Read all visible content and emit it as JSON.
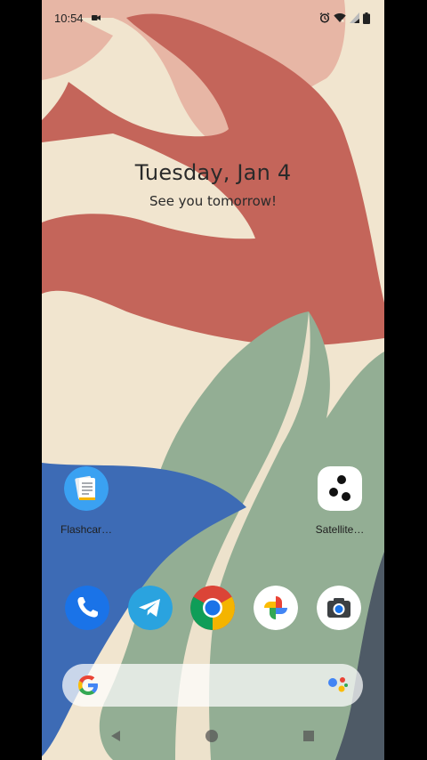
{
  "status_bar": {
    "time": "10:54",
    "icons": [
      "screen-record-icon",
      "alarm-icon",
      "wifi-icon",
      "signal-icon",
      "battery-icon"
    ]
  },
  "glance": {
    "date": "Tuesday, Jan 4",
    "subtitle": "See you tomorrow!"
  },
  "home_apps": [
    {
      "label": "Flashcar…",
      "icon": "flashcards-app-icon"
    },
    {
      "label": "Satellite…",
      "icon": "satellite-app-icon"
    }
  ],
  "dock": [
    {
      "icon": "phone-app-icon"
    },
    {
      "icon": "telegram-app-icon"
    },
    {
      "icon": "chrome-app-icon"
    },
    {
      "icon": "photos-app-icon"
    },
    {
      "icon": "camera-app-icon"
    }
  ],
  "search": {
    "icons": [
      "google-g-icon",
      "assistant-mic-icon"
    ]
  },
  "navigation": {
    "icons": [
      "back-icon",
      "home-icon",
      "recents-icon"
    ]
  },
  "colors": {
    "wallpaper_cream": "#f1e5cf",
    "wallpaper_pink": "#e7b6a5",
    "wallpaper_terracotta": "#c4655a",
    "wallpaper_sage": "#93ae94",
    "wallpaper_blue": "#3d6bb5",
    "wallpaper_slate": "#4e5a66"
  }
}
